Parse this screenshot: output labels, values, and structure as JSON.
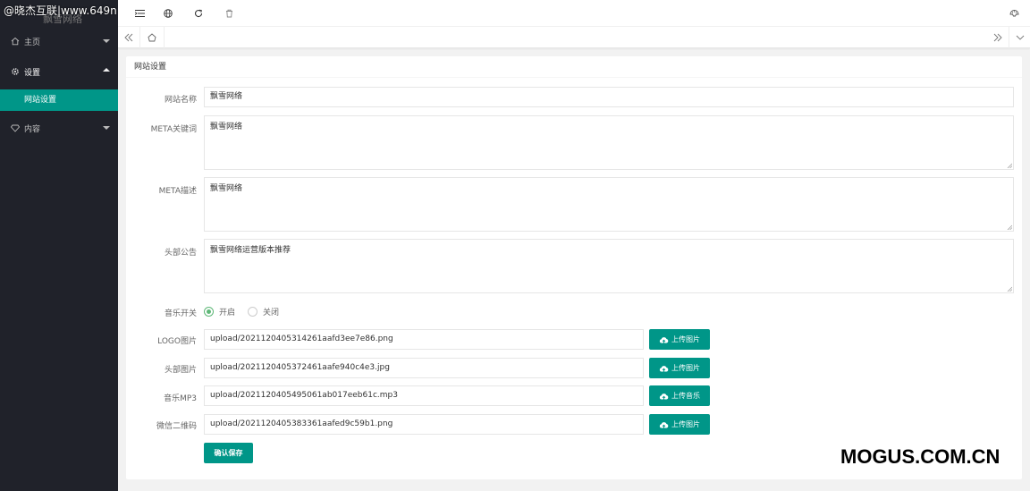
{
  "sidebar": {
    "logo_sub": "飘雪网络",
    "items": [
      {
        "label": "主页",
        "icon": "home-icon"
      },
      {
        "label": "设置",
        "icon": "gear-icon"
      },
      {
        "label": "网站设置"
      },
      {
        "label": "内容",
        "icon": "diamond-icon"
      }
    ]
  },
  "header": {
    "icons": [
      "menu-toggle-icon",
      "globe-icon",
      "refresh-icon",
      "trash-icon",
      "theme-icon"
    ]
  },
  "card": {
    "title": "网站设置",
    "site_name": {
      "label": "网站名称",
      "value": "飘雪网络"
    },
    "meta_keywords": {
      "label": "META关键词",
      "value": "飘雪网络"
    },
    "meta_desc": {
      "label": "META描述",
      "value": "飘雪网络"
    },
    "header_notice": {
      "label": "头部公告",
      "value": "飘雪网络运营版本推荐"
    },
    "music_switch": {
      "label": "音乐开关",
      "on": "开启",
      "off": "关闭",
      "selected": "开启"
    },
    "logo_image": {
      "label": "LOGO图片",
      "value": "upload/20211204053142​61aafd3ee7e86.png",
      "button": "上传图片"
    },
    "header_image": {
      "label": "头部图片",
      "value": "upload/2021120405372461aafe940c4e3.jpg",
      "button": "上传图片"
    },
    "music_mp3": {
      "label": "音乐MP3",
      "value": "upload/2021120405495061ab017eeb61c.mp3",
      "button": "上传音乐"
    },
    "wechat_qr": {
      "label": "微信二维码",
      "value": "upload/2021120405383361aafed9c59b1.png",
      "button": "上传图片"
    },
    "save": "确认保存"
  },
  "watermarks": {
    "top_left": "@晓杰互联|www.649n",
    "bottom_right": "MOGUS.COM.CN"
  },
  "colors": {
    "accent": "#009688",
    "sidebar_bg": "#20222a",
    "radio_checked": "#5FB878"
  }
}
